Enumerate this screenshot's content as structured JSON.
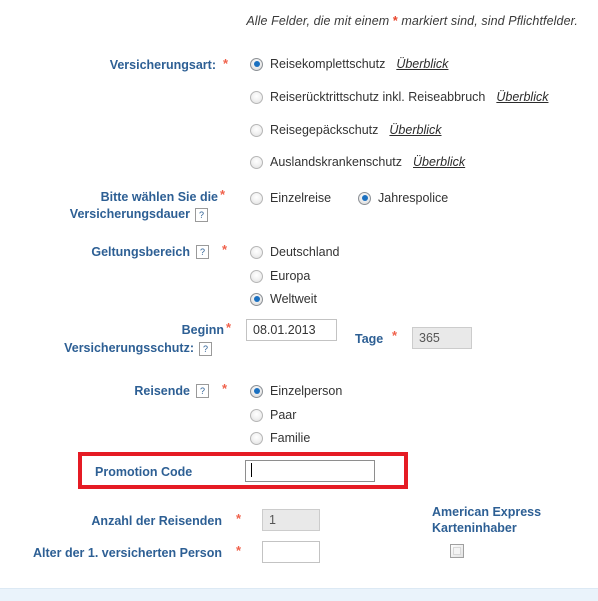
{
  "form": {
    "required_note": {
      "before": "Alle Felder, die mit einem ",
      "asterisk": "*",
      "after": " markiert sind, sind Pflichtfelder."
    },
    "help_icon_glyph": "?",
    "asterisk": "*",
    "sections": {
      "insurance_type": {
        "label": "Versicherungsart:",
        "options": [
          {
            "label": "Reisekomplettschutz",
            "link": "Überblick",
            "checked": true
          },
          {
            "label": "Reiserücktrittschutz inkl. Reiseabbruch",
            "link": "Überblick",
            "checked": false
          },
          {
            "label": "Reisegepäckschutz",
            "link": "Überblick",
            "checked": false
          },
          {
            "label": "Auslandskrankenschutz",
            "link": "Überblick",
            "checked": false
          }
        ]
      },
      "duration": {
        "label_line1": "Bitte wählen Sie die",
        "label_line2": "Versicherungsdauer",
        "options": [
          {
            "label": "Einzelreise",
            "checked": false
          },
          {
            "label": "Jahrespolice",
            "checked": true
          }
        ]
      },
      "scope": {
        "label": "Geltungsbereich",
        "options": [
          {
            "label": "Deutschland",
            "checked": false
          },
          {
            "label": "Europa",
            "checked": false
          },
          {
            "label": "Weltweit",
            "checked": true
          }
        ]
      },
      "start": {
        "label_line1": "Beginn",
        "label_line2": "Versicherungsschutz:",
        "value": "08.01.2013",
        "days_label": "Tage",
        "days_value": "365"
      },
      "travellers": {
        "label": "Reisende",
        "options": [
          {
            "label": "Einzelperson",
            "checked": true
          },
          {
            "label": "Paar",
            "checked": false
          },
          {
            "label": "Familie",
            "checked": false
          }
        ]
      },
      "promotion": {
        "label": "Promotion Code",
        "value": "",
        "highlight_color": "#e51b24",
        "focused": true
      },
      "count": {
        "label": "Anzahl der Reisenden",
        "value": "1"
      },
      "age": {
        "label": "Alter der 1. versicherten Person",
        "value": ""
      },
      "amex": {
        "label_line1": "American Express",
        "label_line2": "Karteninhaber",
        "checked": false
      }
    }
  },
  "colors": {
    "label_blue": "#2d5f94",
    "asterisk_red": "#f0614b",
    "highlight_red": "#e51b24",
    "radio_dot_blue": "#1b70c0"
  }
}
